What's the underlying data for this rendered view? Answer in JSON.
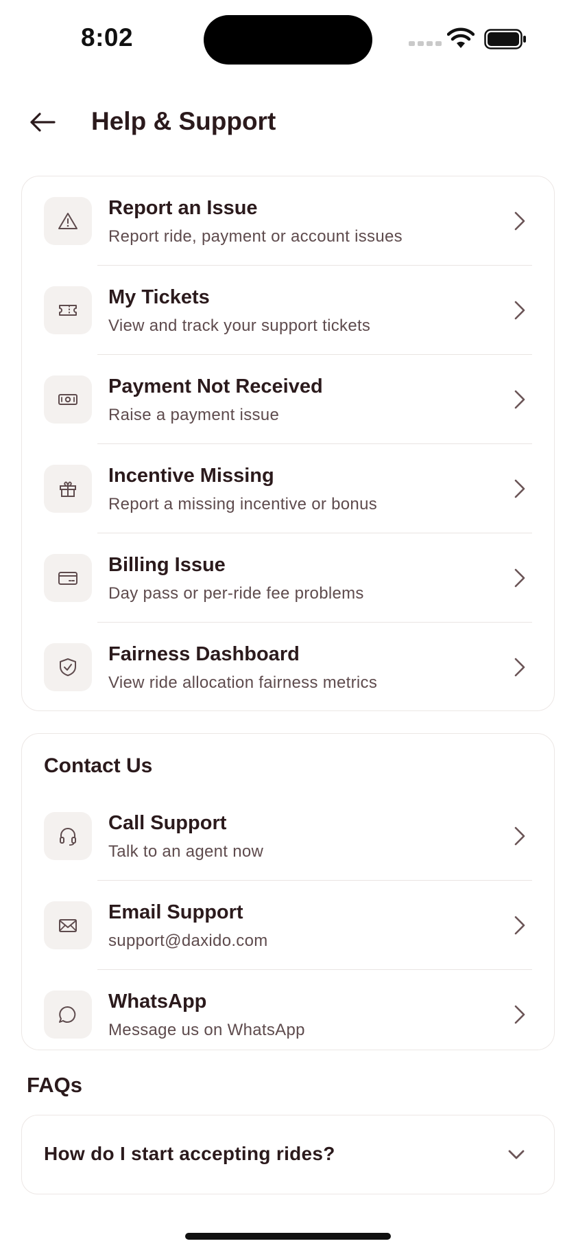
{
  "status_bar": {
    "time": "8:02"
  },
  "header": {
    "title": "Help & Support",
    "back_icon": "arrow-left-icon"
  },
  "support_items": [
    {
      "icon": "warning-triangle-icon",
      "title": "Report an Issue",
      "subtitle": "Report ride, payment or account issues"
    },
    {
      "icon": "ticket-icon",
      "title": "My Tickets",
      "subtitle": "View and track your support tickets"
    },
    {
      "icon": "banknote-icon",
      "title": "Payment Not Received",
      "subtitle": "Raise a payment issue"
    },
    {
      "icon": "gift-icon",
      "title": "Incentive Missing",
      "subtitle": "Report a missing incentive or bonus"
    },
    {
      "icon": "credit-card-icon",
      "title": "Billing Issue",
      "subtitle": "Day pass or per-ride fee problems"
    },
    {
      "icon": "shield-check-icon",
      "title": "Fairness Dashboard",
      "subtitle": "View ride allocation fairness metrics"
    }
  ],
  "contact": {
    "heading": "Contact Us",
    "items": [
      {
        "icon": "headset-icon",
        "title": "Call Support",
        "subtitle": "Talk to an agent now"
      },
      {
        "icon": "mail-icon",
        "title": "Email Support",
        "subtitle": "support@daxido.com"
      },
      {
        "icon": "chat-bubble-icon",
        "title": "WhatsApp",
        "subtitle": "Message us on WhatsApp"
      }
    ]
  },
  "faqs": {
    "heading": "FAQs",
    "items": [
      {
        "question": "How do I start accepting rides?"
      }
    ]
  },
  "colors": {
    "text": "#2b1a1c",
    "subtext": "#5e4b4d",
    "icon_bg": "#f4f1ef",
    "border": "#ece7e5",
    "chevron": "#6b5557"
  }
}
